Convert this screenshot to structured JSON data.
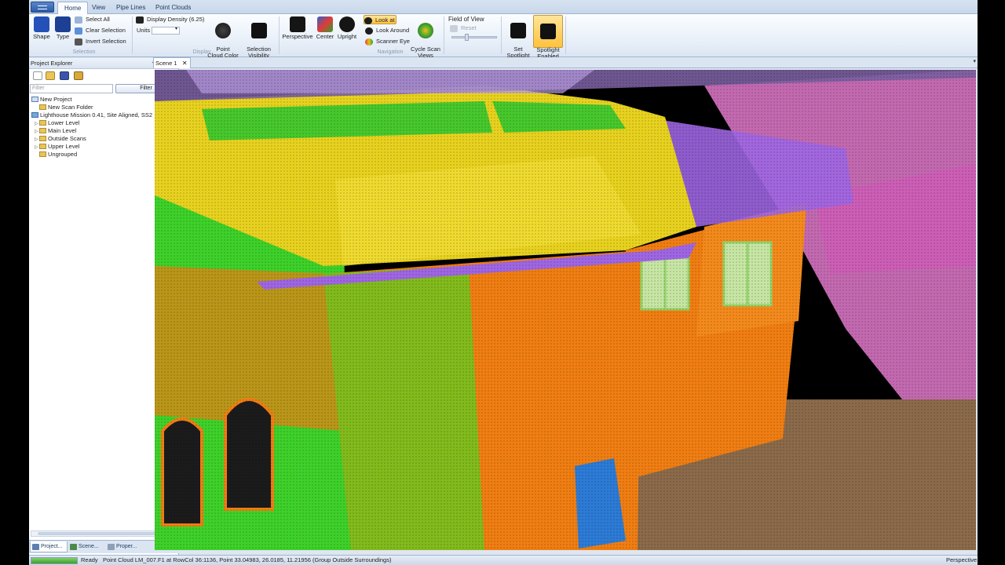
{
  "tabs": [
    "Home",
    "View",
    "Pipe Lines",
    "Point Clouds"
  ],
  "ribbon": {
    "selection": {
      "shape": "Shape",
      "type": "Type",
      "select_all": "Select All",
      "clear_selection": "Clear Selection",
      "invert_selection": "Invert Selection",
      "caption": "Selection"
    },
    "display": {
      "density": "Display Density (6.25)",
      "units": "Units",
      "point_cloud_color": "Point\nCloud Color",
      "selection_visibility": "Selection\nVisibility",
      "caption": "Display"
    },
    "navigation": {
      "perspective": "Perspective",
      "center": "Center",
      "upright": "Upright",
      "look_at": "Look at",
      "look_around": "Look Around",
      "scanner_eye": "Scanner Eye",
      "cycle_scan_views": "Cycle Scan\nViews",
      "caption": "Navigation"
    },
    "field_of_view": {
      "label": "Field of View",
      "reset": "Reset"
    },
    "spotlight": {
      "set": "Set\nSpotlight",
      "enabled": "Spotlight\nEnabled"
    }
  },
  "explorer": {
    "title": "Project Explorer",
    "filter_placeholder": "Filter",
    "filter_button": "Filter",
    "tree": [
      "New Project",
      "New Scan Folder",
      "Lighthouse Mission 0.41, Site Aligned, SS2",
      "Lower Level",
      "Main Level",
      "Outside Scans",
      "Upper Level",
      "Ungrouped"
    ],
    "bottom_tabs": [
      "Project...",
      "Scene...",
      "Proper..."
    ]
  },
  "scene": {
    "tab": "Scene 1",
    "view_mode": "Perspective"
  },
  "status": {
    "ready": "Ready",
    "message": "Point Cloud LM_007.F1 at RowCol 36:1136, Point 33.04983, 26.0185, 11.21956 (Group Outside Surroundings)",
    "progress": 1.0
  },
  "colors": {
    "ribbon": "#e6eef8",
    "accent": "#ffc23d",
    "facade": "#f07e12",
    "roof": "#e8d21f",
    "sky": "#9f66e3",
    "pink": "#e57bcf",
    "green": "#3ed12a",
    "ground": "#8b6a4a"
  }
}
